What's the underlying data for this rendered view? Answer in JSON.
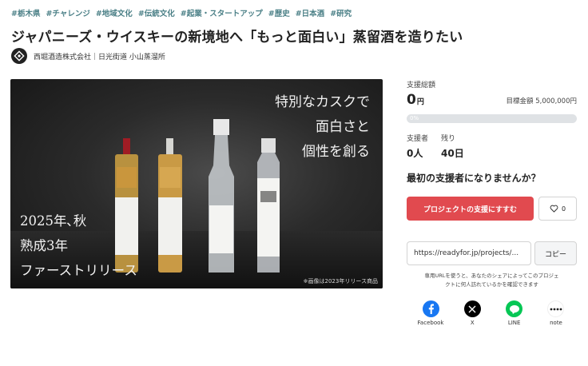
{
  "tags": [
    "#栃木県",
    "#チャレンジ",
    "#地域文化",
    "#伝統文化",
    "#起業・スタートアップ",
    "#歴史",
    "#日本酒",
    "#研究"
  ],
  "project": {
    "title": "ジャパニーズ・ウイスキーの新境地へ「もっと面白い」蒸留酒を造りたい",
    "owner": "西堀酒造株式会社｜日光街道 小山蒸溜所"
  },
  "hero": {
    "copy_lines": [
      "特別なカスクで",
      "面白さと",
      "個性を創る"
    ],
    "left_lines": [
      "2025年､秋",
      "熟成3年",
      "ファーストリリース"
    ],
    "note": "※画像は2023年リリース商品"
  },
  "stats": {
    "total_label": "支援総額",
    "amount": "0",
    "amount_unit": "円",
    "goal": "目標金額 5,000,000円",
    "progress_text": "0%",
    "progress": 0,
    "supporters_label": "支援者",
    "supporters_value": "0人",
    "remaining_label": "残り",
    "remaining_value": "40日"
  },
  "cta_text": "最初の支援者になりませんか？",
  "buttons": {
    "support": "プロジェクトの支援にすすむ",
    "like_count": "0",
    "copy": "コピー"
  },
  "share": {
    "url": "https://readyfor.jp/projects/...",
    "note_line1": "専用URLを使うと、あなたのシェアによってこのプロジェ",
    "note_line2": "クトに何人訪れているかを確認できます"
  },
  "social": [
    {
      "label": "Facebook",
      "icon": "facebook-icon",
      "color": "#1877f2"
    },
    {
      "label": "X",
      "icon": "x-icon",
      "color": "#000000"
    },
    {
      "label": "LINE",
      "icon": "line-icon",
      "color": "#06c755"
    },
    {
      "label": "note",
      "icon": "note-icon",
      "color": "#ffffff"
    }
  ]
}
